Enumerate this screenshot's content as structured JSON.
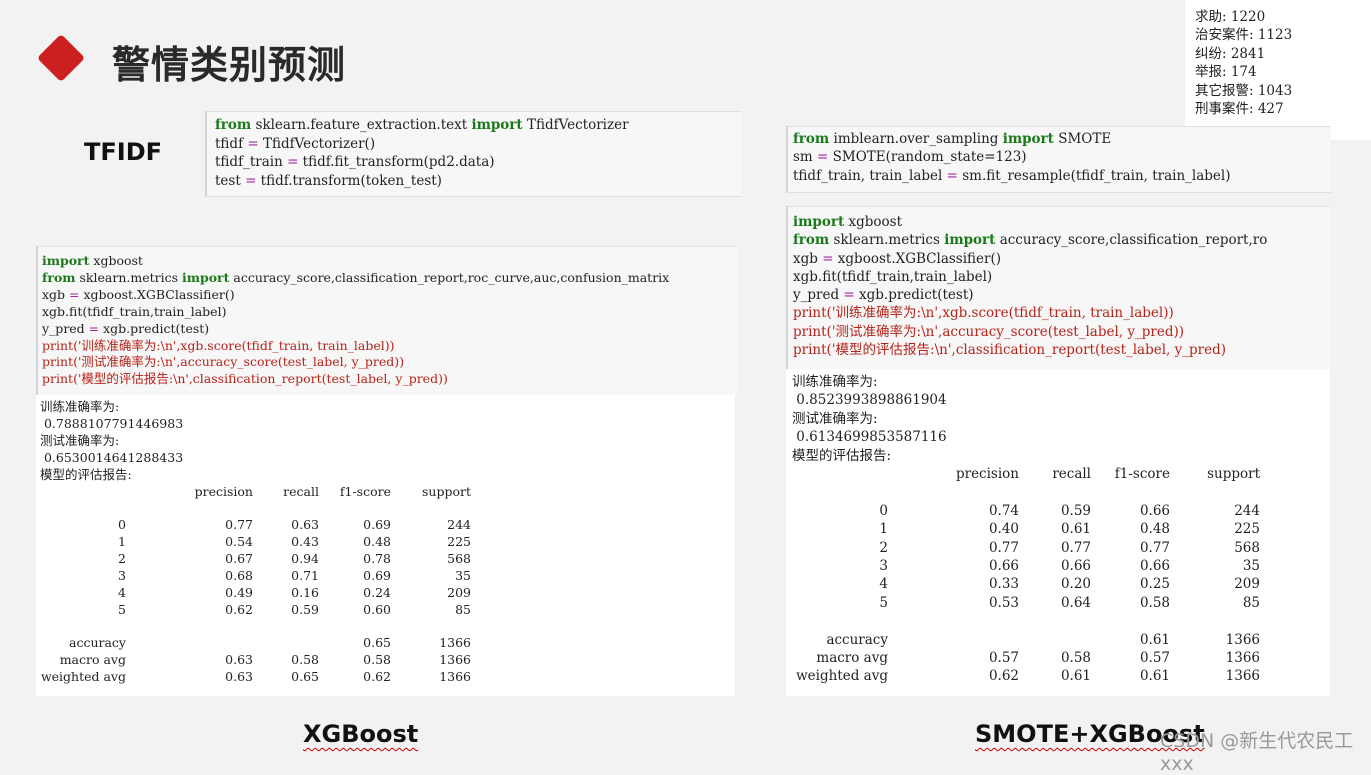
{
  "header": {
    "title": "警情类别预测"
  },
  "labels": {
    "tfidf": "TFIDF",
    "xgboost": "XGBoost",
    "smote_xgboost": "SMOTE+XGBoost"
  },
  "watermark": "CSDN @新生代农民工xxx",
  "stats": [
    "求助: 1220",
    "治安案件: 1123",
    "纠纷: 2841",
    "举报: 174",
    "其它报警: 1043",
    "刑事案件: 427"
  ],
  "tfidf_code": [
    "from sklearn.feature_extraction.text import TfidfVectorizer",
    "tfidf = TfidfVectorizer()",
    "tfidf_train = tfidf.fit_transform(pd2.data)",
    "test = tfidf.transform(token_test)"
  ],
  "xgb_code": [
    "import xgboost",
    "from sklearn.metrics import accuracy_score,classification_report,roc_curve,auc,confusion_matrix",
    "xgb = xgboost.XGBClassifier()",
    "xgb.fit(tfidf_train,train_label)",
    "y_pred = xgb.predict(test)",
    "print('训练准确率为:\\n',xgb.score(tfidf_train, train_label))",
    "print('测试准确率为:\\n',accuracy_score(test_label, y_pred))",
    "print('模型的评估报告:\\n',classification_report(test_label, y_pred))"
  ],
  "xgb_output": {
    "train_label": "训练准确率为:",
    "train_value": " 0.7888107791446983",
    "test_label": "测试准确率为:",
    "test_value": " 0.6530014641288433",
    "report_label": "模型的评估报告:",
    "header": [
      "",
      "precision",
      "recall",
      "f1-score",
      "support"
    ],
    "rows": [
      [
        "0",
        "0.77",
        "0.63",
        "0.69",
        "244"
      ],
      [
        "1",
        "0.54",
        "0.43",
        "0.48",
        "225"
      ],
      [
        "2",
        "0.67",
        "0.94",
        "0.78",
        "568"
      ],
      [
        "3",
        "0.68",
        "0.71",
        "0.69",
        "35"
      ],
      [
        "4",
        "0.49",
        "0.16",
        "0.24",
        "209"
      ],
      [
        "5",
        "0.62",
        "0.59",
        "0.60",
        "85"
      ]
    ],
    "summary": [
      [
        "accuracy",
        "",
        "",
        "0.65",
        "1366"
      ],
      [
        "macro avg",
        "0.63",
        "0.58",
        "0.58",
        "1366"
      ],
      [
        "weighted avg",
        "0.63",
        "0.65",
        "0.62",
        "1366"
      ]
    ]
  },
  "smote_code": [
    "from imblearn.over_sampling import SMOTE",
    "sm = SMOTE(random_state=123)",
    "tfidf_train, train_label = sm.fit_resample(tfidf_train, train_label)"
  ],
  "smote_xgb_code": [
    "import xgboost",
    "from sklearn.metrics import accuracy_score,classification_report,ro",
    "xgb = xgboost.XGBClassifier()",
    "xgb.fit(tfidf_train,train_label)",
    "y_pred = xgb.predict(test)",
    "print('训练准确率为:\\n',xgb.score(tfidf_train, train_label))",
    "print('测试准确率为:\\n',accuracy_score(test_label, y_pred))",
    "print('模型的评估报告:\\n',classification_report(test_label, y_pred)"
  ],
  "smote_output": {
    "train_label": "训练准确率为:",
    "train_value": " 0.8523993898861904",
    "test_label": "测试准确率为:",
    "test_value": " 0.6134699853587116",
    "report_label": "模型的评估报告:",
    "header": [
      "",
      "precision",
      "recall",
      "f1-score",
      "support"
    ],
    "rows": [
      [
        "0",
        "0.74",
        "0.59",
        "0.66",
        "244"
      ],
      [
        "1",
        "0.40",
        "0.61",
        "0.48",
        "225"
      ],
      [
        "2",
        "0.77",
        "0.77",
        "0.77",
        "568"
      ],
      [
        "3",
        "0.66",
        "0.66",
        "0.66",
        "35"
      ],
      [
        "4",
        "0.33",
        "0.20",
        "0.25",
        "209"
      ],
      [
        "5",
        "0.53",
        "0.64",
        "0.58",
        "85"
      ]
    ],
    "summary": [
      [
        "accuracy",
        "",
        "",
        "0.61",
        "1366"
      ],
      [
        "macro avg",
        "0.57",
        "0.58",
        "0.57",
        "1366"
      ],
      [
        "weighted avg",
        "0.62",
        "0.61",
        "0.61",
        "1366"
      ]
    ]
  }
}
